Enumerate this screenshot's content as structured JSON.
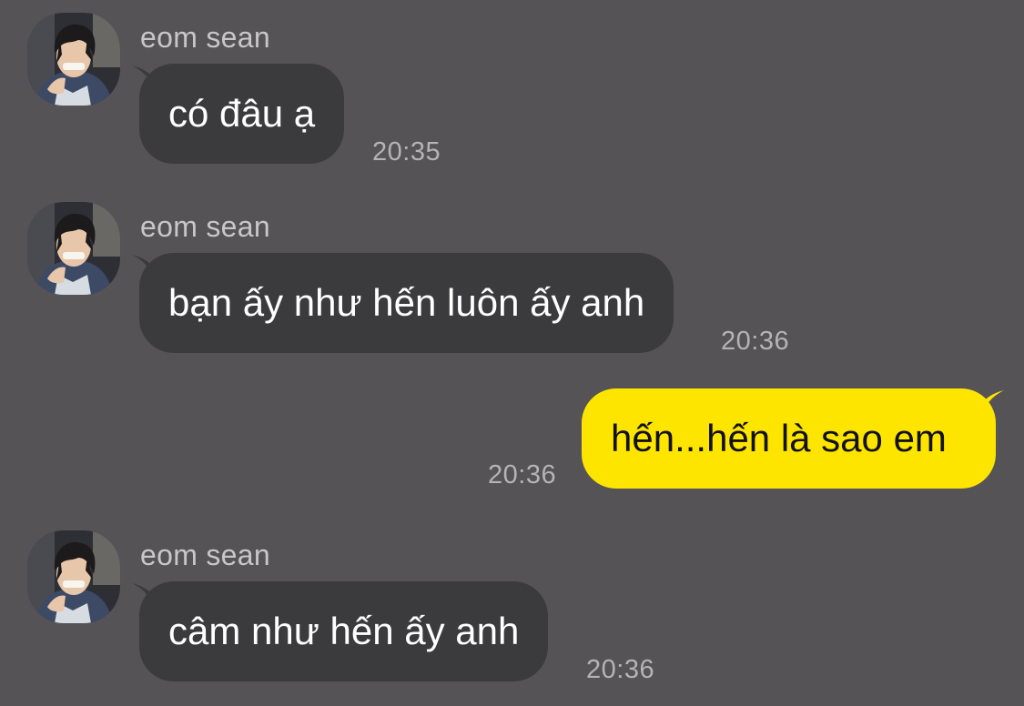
{
  "colors": {
    "background": "#555356",
    "incoming_bubble": "#3b3a3d",
    "outgoing_bubble": "#fee500",
    "sender_name": "#c7c6c9",
    "timestamp": "#b4b3b6"
  },
  "messages": [
    {
      "direction": "incoming",
      "sender": "eom sean",
      "avatar_icon": "profile-photo",
      "text": "có đâu ạ",
      "time": "20:35"
    },
    {
      "direction": "incoming",
      "sender": "eom sean",
      "avatar_icon": "profile-photo",
      "text": "bạn ấy như hến luôn ấy anh",
      "time": "20:36"
    },
    {
      "direction": "outgoing",
      "text": "hến...hến là sao em",
      "time": "20:36"
    },
    {
      "direction": "incoming",
      "sender": "eom sean",
      "avatar_icon": "profile-photo",
      "text": "câm như hến ấy anh",
      "time": "20:36"
    }
  ]
}
